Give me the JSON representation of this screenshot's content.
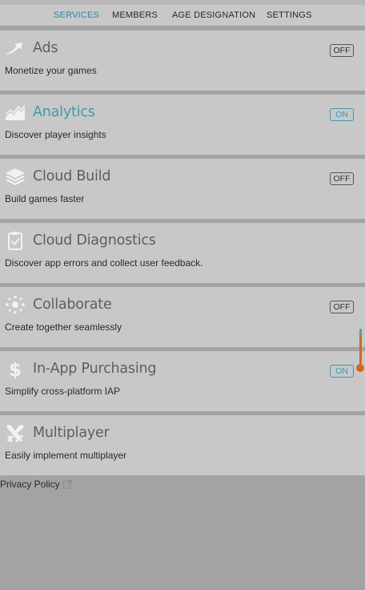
{
  "tabs": [
    {
      "label": "SERVICES",
      "active": true
    },
    {
      "label": "MEMBERS",
      "active": false
    },
    {
      "label": "AGE DESIGNATION",
      "active": false
    },
    {
      "label": "SETTINGS",
      "active": false
    }
  ],
  "services": [
    {
      "title": "Ads",
      "description": "Monetize your games",
      "toggle": "OFF",
      "enabled": false,
      "icon": "ads-arrow-icon"
    },
    {
      "title": "Analytics",
      "description": "Discover player insights",
      "toggle": "ON",
      "enabled": true,
      "icon": "analytics-chart-icon"
    },
    {
      "title": "Cloud Build",
      "description": "Build games faster",
      "toggle": "OFF",
      "enabled": false,
      "icon": "cloud-build-layers-icon"
    },
    {
      "title": "Cloud Diagnostics",
      "description": "Discover app errors and collect user feedback.",
      "toggle": "",
      "enabled": false,
      "icon": "clipboard-check-icon"
    },
    {
      "title": "Collaborate",
      "description": "Create together seamlessly",
      "toggle": "OFF",
      "enabled": false,
      "icon": "collaborate-icon"
    },
    {
      "title": "In-App Purchasing",
      "description": "Simplify cross-platform IAP",
      "toggle": "ON",
      "enabled": true,
      "icon": "dollar-icon"
    },
    {
      "title": "Multiplayer",
      "description": "Easily implement multiplayer",
      "toggle": "",
      "enabled": false,
      "icon": "crossed-swords-icon"
    }
  ],
  "footer": {
    "privacy_label": "Privacy Policy"
  },
  "colors": {
    "accent": "#3a9bb0",
    "card": "#c8c8c8",
    "background": "#a3a3a3",
    "scrollbar_thumb": "#d2691e"
  }
}
